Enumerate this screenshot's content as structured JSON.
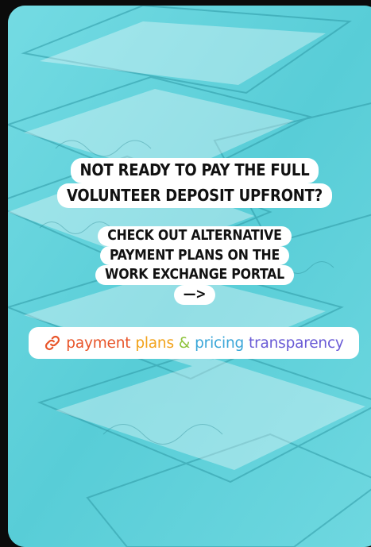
{
  "caption_top": {
    "lines": [
      "NOT READY TO PAY THE FULL",
      "VOLUNTEER DEPOSIT UPFRONT?"
    ]
  },
  "caption_bottom": {
    "lines": [
      "CHECK OUT ALTERNATIVE",
      "PAYMENT PLANS ON THE",
      "WORK EXCHANGE PORTAL",
      "—>"
    ]
  },
  "link_sticker": {
    "words": [
      "payment",
      "plans",
      "&",
      "pricing",
      "transparency"
    ],
    "word_colors": [
      "#e8552a",
      "#f2a31b",
      "#8fc43c",
      "#3aa6d8",
      "#6a5bd6"
    ]
  },
  "colors": {
    "background_tint": "#5ed3dc",
    "caption_bg": "#ffffff",
    "caption_text": "#111111"
  }
}
